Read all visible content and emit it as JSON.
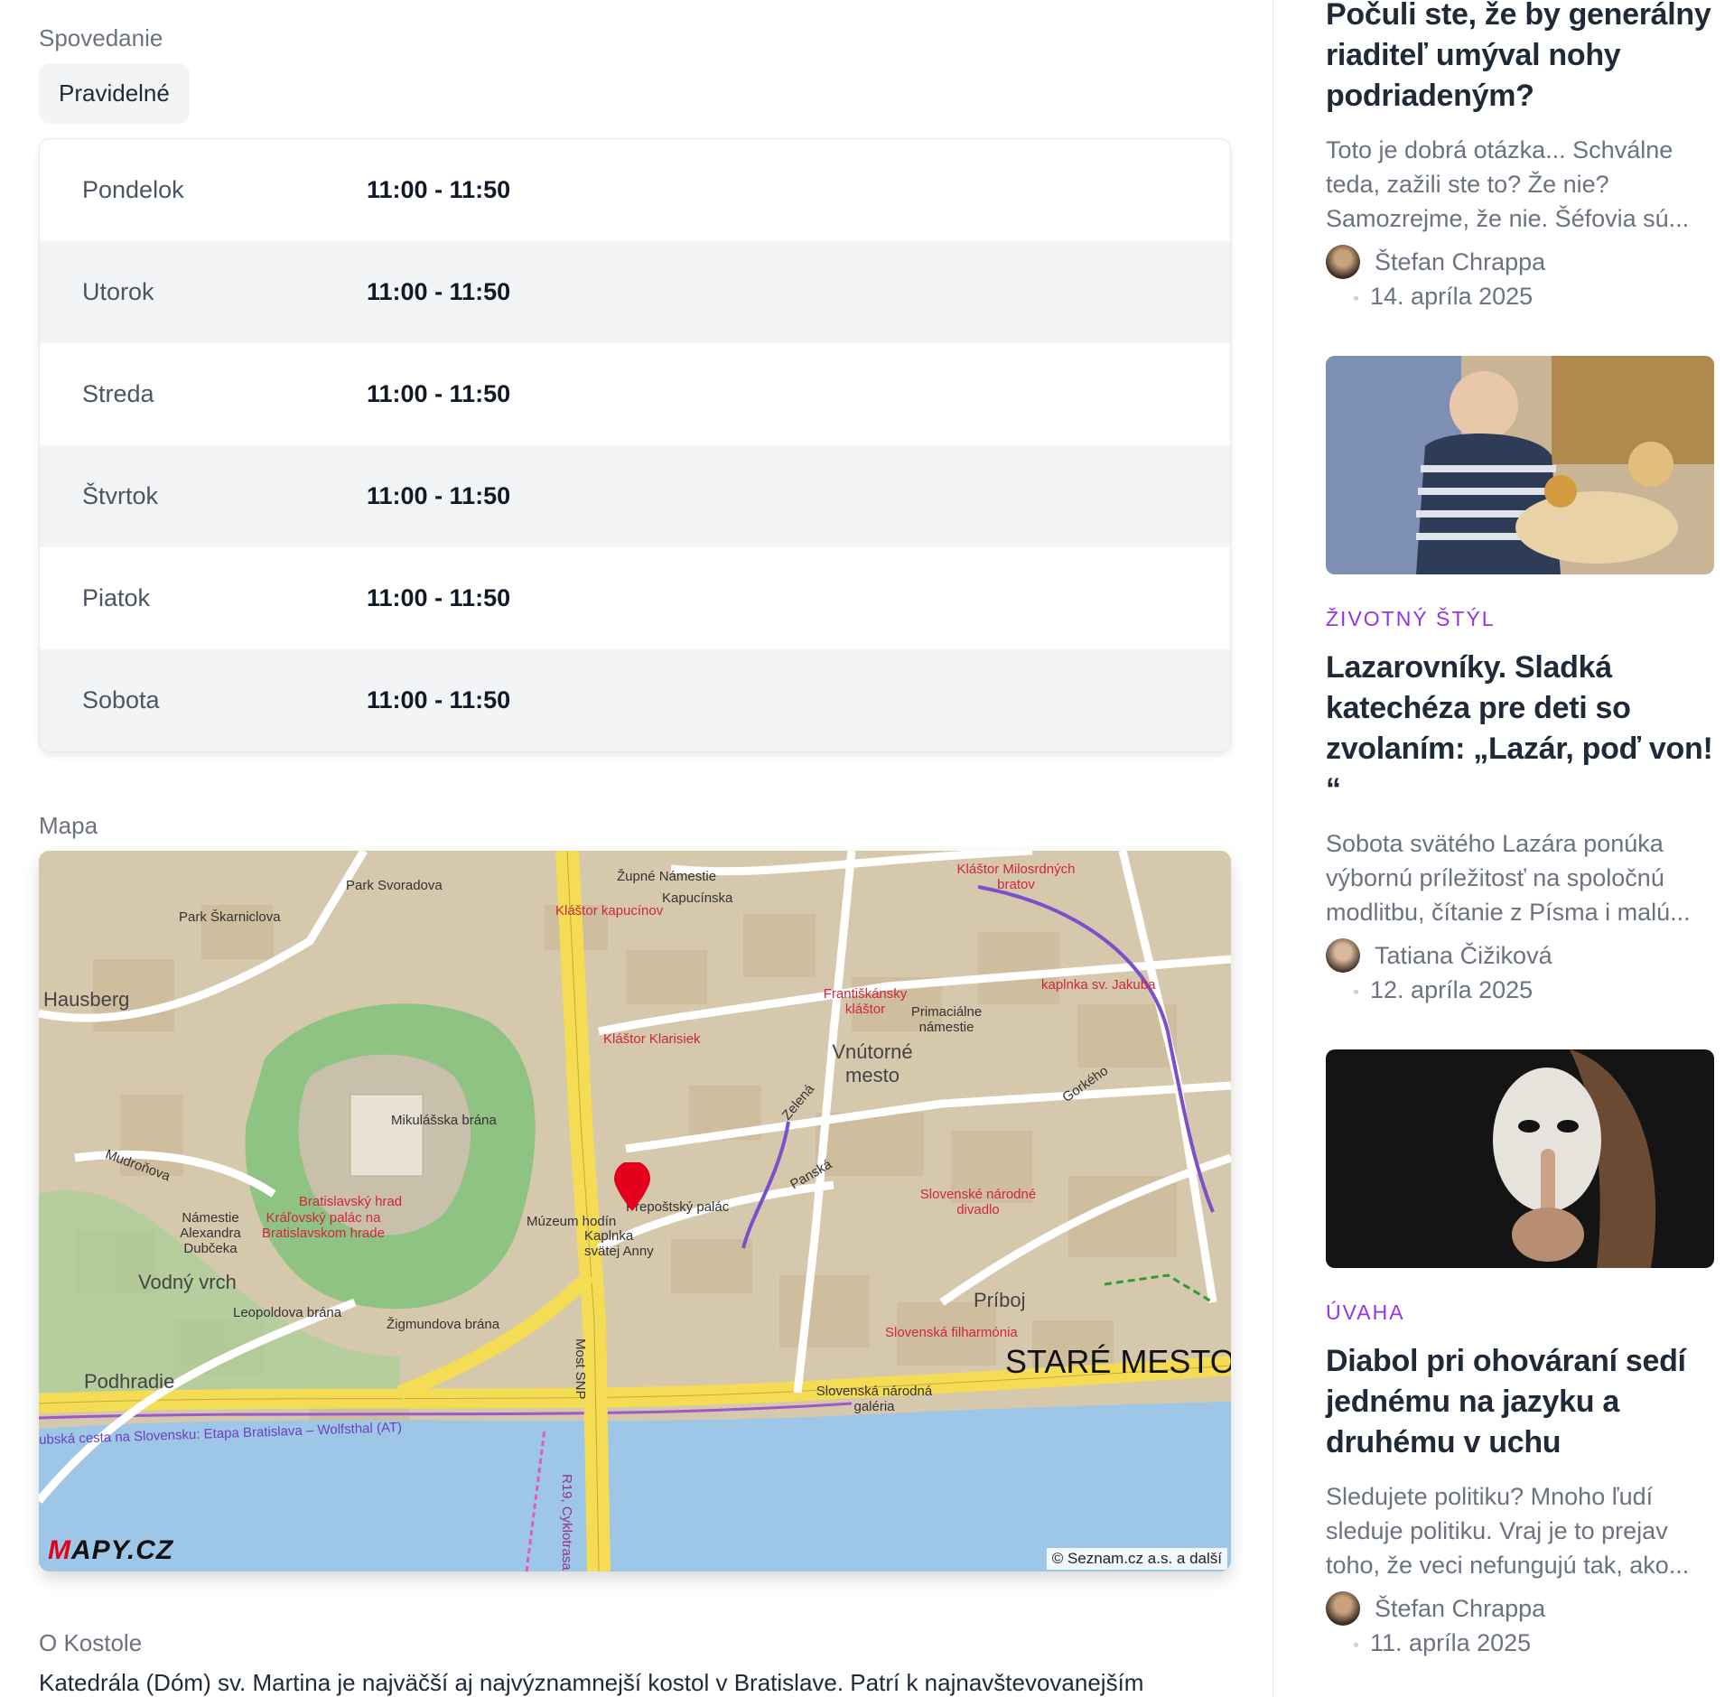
{
  "confession": {
    "label": "Spovedanie",
    "pill": "Pravidelné",
    "schedule": [
      {
        "day": "Pondelok",
        "time": "11:00 - 11:50"
      },
      {
        "day": "Utorok",
        "time": "11:00 - 11:50"
      },
      {
        "day": "Streda",
        "time": "11:00 - 11:50"
      },
      {
        "day": "Štvrtok",
        "time": "11:00 - 11:50"
      },
      {
        "day": "Piatok",
        "time": "11:00 - 11:50"
      },
      {
        "day": "Sobota",
        "time": "11:00 - 11:50"
      }
    ]
  },
  "map": {
    "label": "Mapa",
    "logo_prefix": "M",
    "logo_rest": "APY.CZ",
    "credit": "© Seznam.cz a.s. a další",
    "places": {
      "stare_mesto": "STARÉ MESTO",
      "vnutorne_mesto": "Vnútorné mesto",
      "vodny_vrch": "Vodný vrch",
      "podhradie": "Podhradie",
      "hausberg": "Hausberg",
      "priboj": "Príboj",
      "hrad": "Bratislavský hrad",
      "kralovsky": "Kráľovský palác na Bratislavskom hrade",
      "zupne": "Župné Námestie",
      "kapucinska": "Kapucínska",
      "klastor_kapucinov": "Kláštor kapucínov",
      "klastor_klarisiek": "Kláštor Klarisiek",
      "frantiskansky": "Františkánsky kláštor",
      "primacialne": "Primaciálne námestie",
      "snd": "Slovenské národné divadlo",
      "filharmonia": "Slovenská filharmónia",
      "klastor_milos": "Kláštor Milosrdných bratov",
      "jakub": "kaplnka sv. Jakuba",
      "most_snp": "Most SNP",
      "narodna_galeria": "Slovenská národná galéria",
      "park_skarniclova": "Park Škarniclova",
      "park_svoradova": "Park Svoradova",
      "mikulasska": "Mikulášska brána",
      "zigmundova": "Žigmundova brána",
      "leopoldova": "Leopoldova brána",
      "muzeum_hodin": "Múzeum hodín",
      "kaplnka_anny": "Kaplnka svätej Anny",
      "prepostsky": "Prepoštský palác",
      "namestie_dubceka": "Námestie Alexandra Dubčeka",
      "cyklo": "ubská cesta na Slovensku: Etapa Bratislava – Wolfsthal (AT)",
      "r19": "R19, Cyklotrasa",
      "mudronova": "Mudroňova",
      "panska": "Panská",
      "zelena": "Zelená",
      "gorkeho": "Gorkého"
    }
  },
  "about": {
    "label": "O Kostole",
    "text": "Katedrála (Dóm) sv. Martina je najväčší aj najvýznamnejší kostol v Bratislave. Patrí k najnavštevovanejším"
  },
  "articles": [
    {
      "title": "Počuli ste, že by generálny riaditeľ umýval nohy podriadeným?",
      "excerpt": "Toto je dobrá otázka... Schválne teda, zažili ste to? Že nie? Samozrejme, že nie. Šéfovia sú...",
      "author": "Štefan Chrappa",
      "date": "14. apríla 2025"
    },
    {
      "category": "ŽIVOTNÝ ŠTÝL",
      "title": "Lazarovníky. Sladká katechéza pre deti so zvolaním: „Lazár, poď von! “",
      "excerpt": "Sobota svätého Lazára ponúka výbornú príležitosť na spoločnú modlitbu, čítanie z Písma i malú...",
      "author": "Tatiana Čižiková",
      "date": "12. apríla 2025"
    },
    {
      "category": "ÚVAHA",
      "title": "Diabol pri ohováraní sedí jednému na jazyku a druhému v uchu",
      "excerpt": "Sledujete politiku? Mnoho ľudí sleduje politiku. Vraj je to prejav toho, že veci nefungujú tak, ako...",
      "author": "Štefan Chrappa",
      "date": "11. apríla 2025"
    }
  ],
  "colors": {
    "category": "#9333ea",
    "pin": "#e2001a",
    "road": "#f4dc55",
    "water": "#9ec6e6",
    "park": "#8fc383"
  }
}
